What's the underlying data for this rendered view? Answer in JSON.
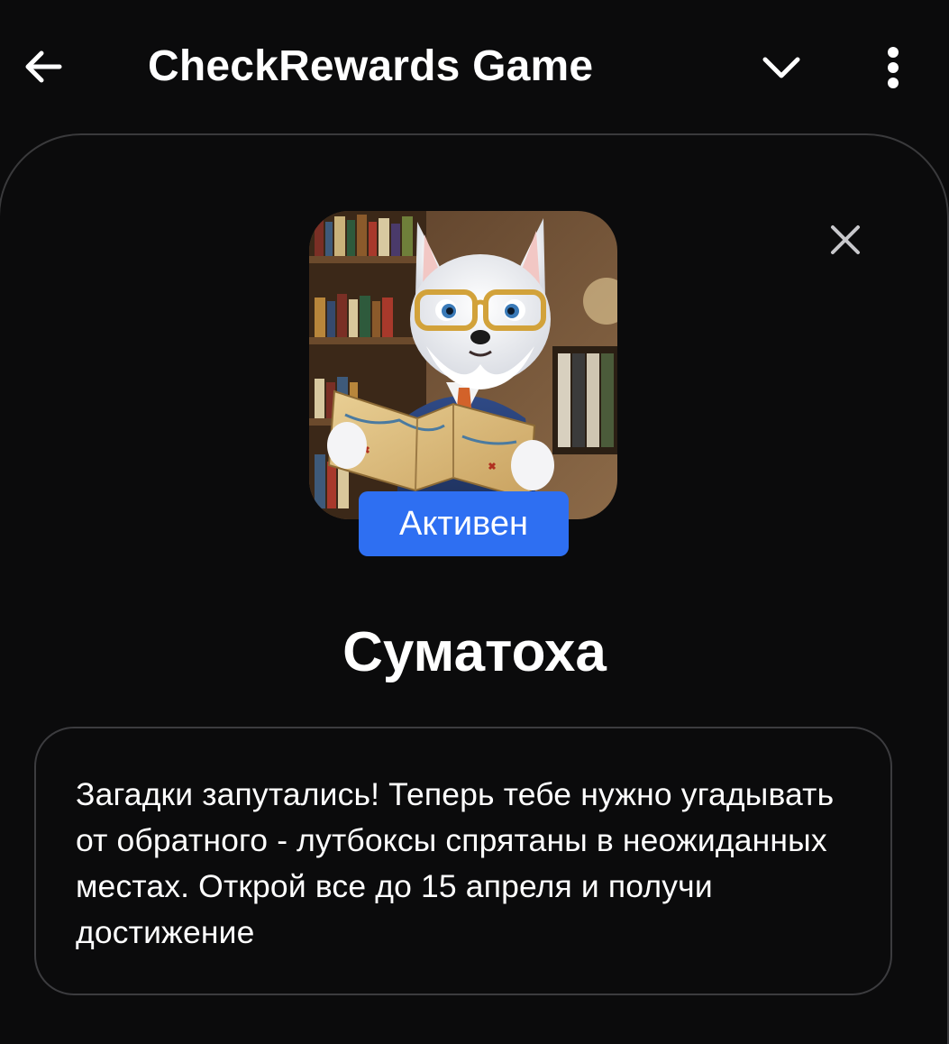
{
  "header": {
    "title": "CheckRewards Game",
    "icons": {
      "back": "arrow-left-icon",
      "collapse": "chevron-down-icon",
      "more": "more-vertical-icon"
    }
  },
  "event": {
    "status": "Активен",
    "title": "Суматоха",
    "description": "Загадки запутались! Теперь тебе нужно угадывать от обратного - лутбоксы спрятаны в неожиданных местах. Открой все до 15 апреля и получи достижение",
    "image": "fox-with-map-illustration",
    "close_icon": "close-icon"
  },
  "colors": {
    "background": "#0b0b0c",
    "accent": "#2e6ff2",
    "border": "#3a3a3c",
    "text": "#ffffff"
  }
}
